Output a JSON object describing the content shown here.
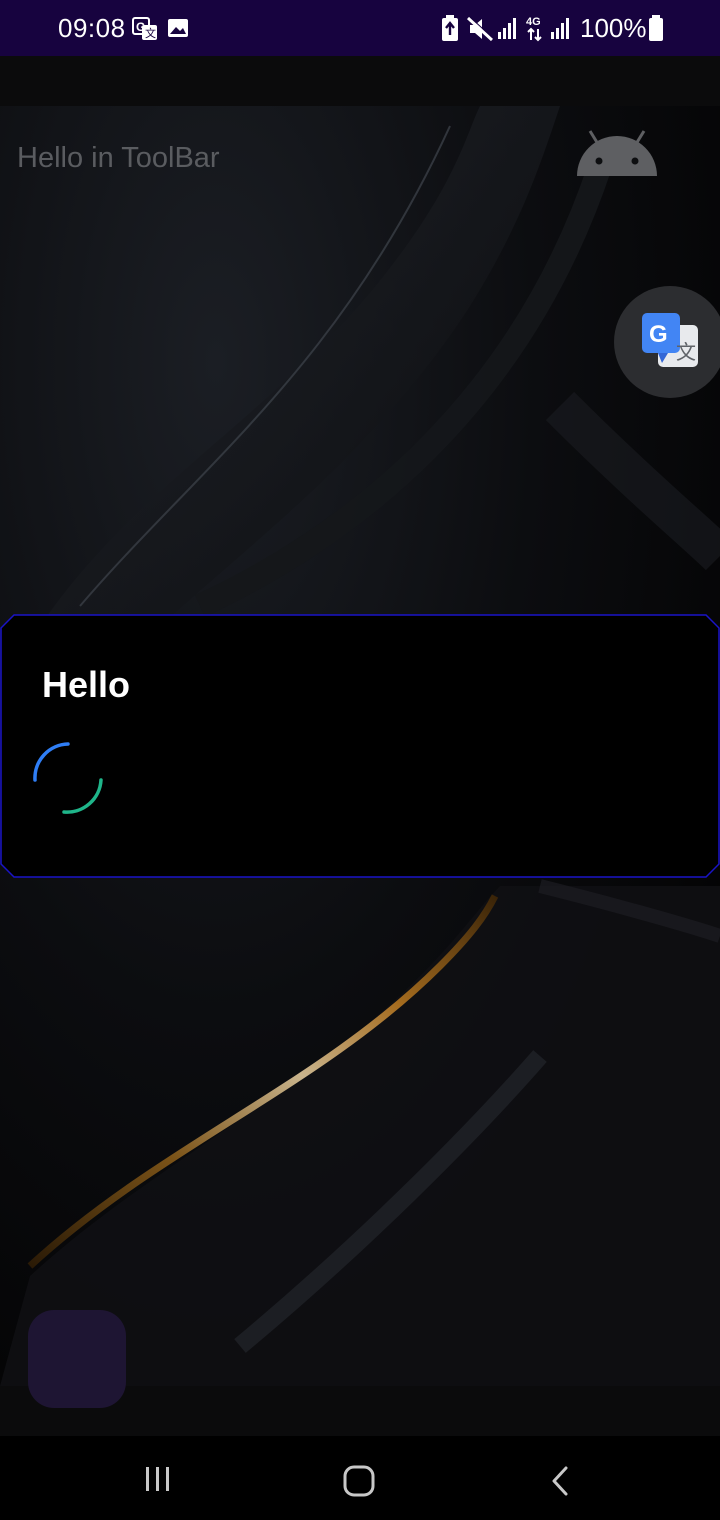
{
  "status_bar": {
    "time": "09:08",
    "battery_percent": "100%",
    "icons": [
      "translate-notification-icon",
      "image-notification-icon",
      "battery-saver-icon",
      "mute-icon",
      "signal-icon",
      "4g-data-icon",
      "signal-icon-2",
      "battery-icon"
    ]
  },
  "toolbar": {
    "title": "Hello in ToolBar",
    "icon": "android-icon"
  },
  "floating": {
    "translate_button_icon": "google-translate-icon"
  },
  "dialog": {
    "title": "Hello",
    "indicator": "progress-spinner"
  },
  "navigation_bar": {
    "buttons": [
      "recents-button",
      "home-button",
      "back-button"
    ]
  },
  "colors": {
    "status_bar": "#17033f",
    "dialog_border": "#1a14c8",
    "spinner_blue": "#2f7ef5",
    "spinner_green": "#1fb58a",
    "fab_square": "#1e1533"
  }
}
